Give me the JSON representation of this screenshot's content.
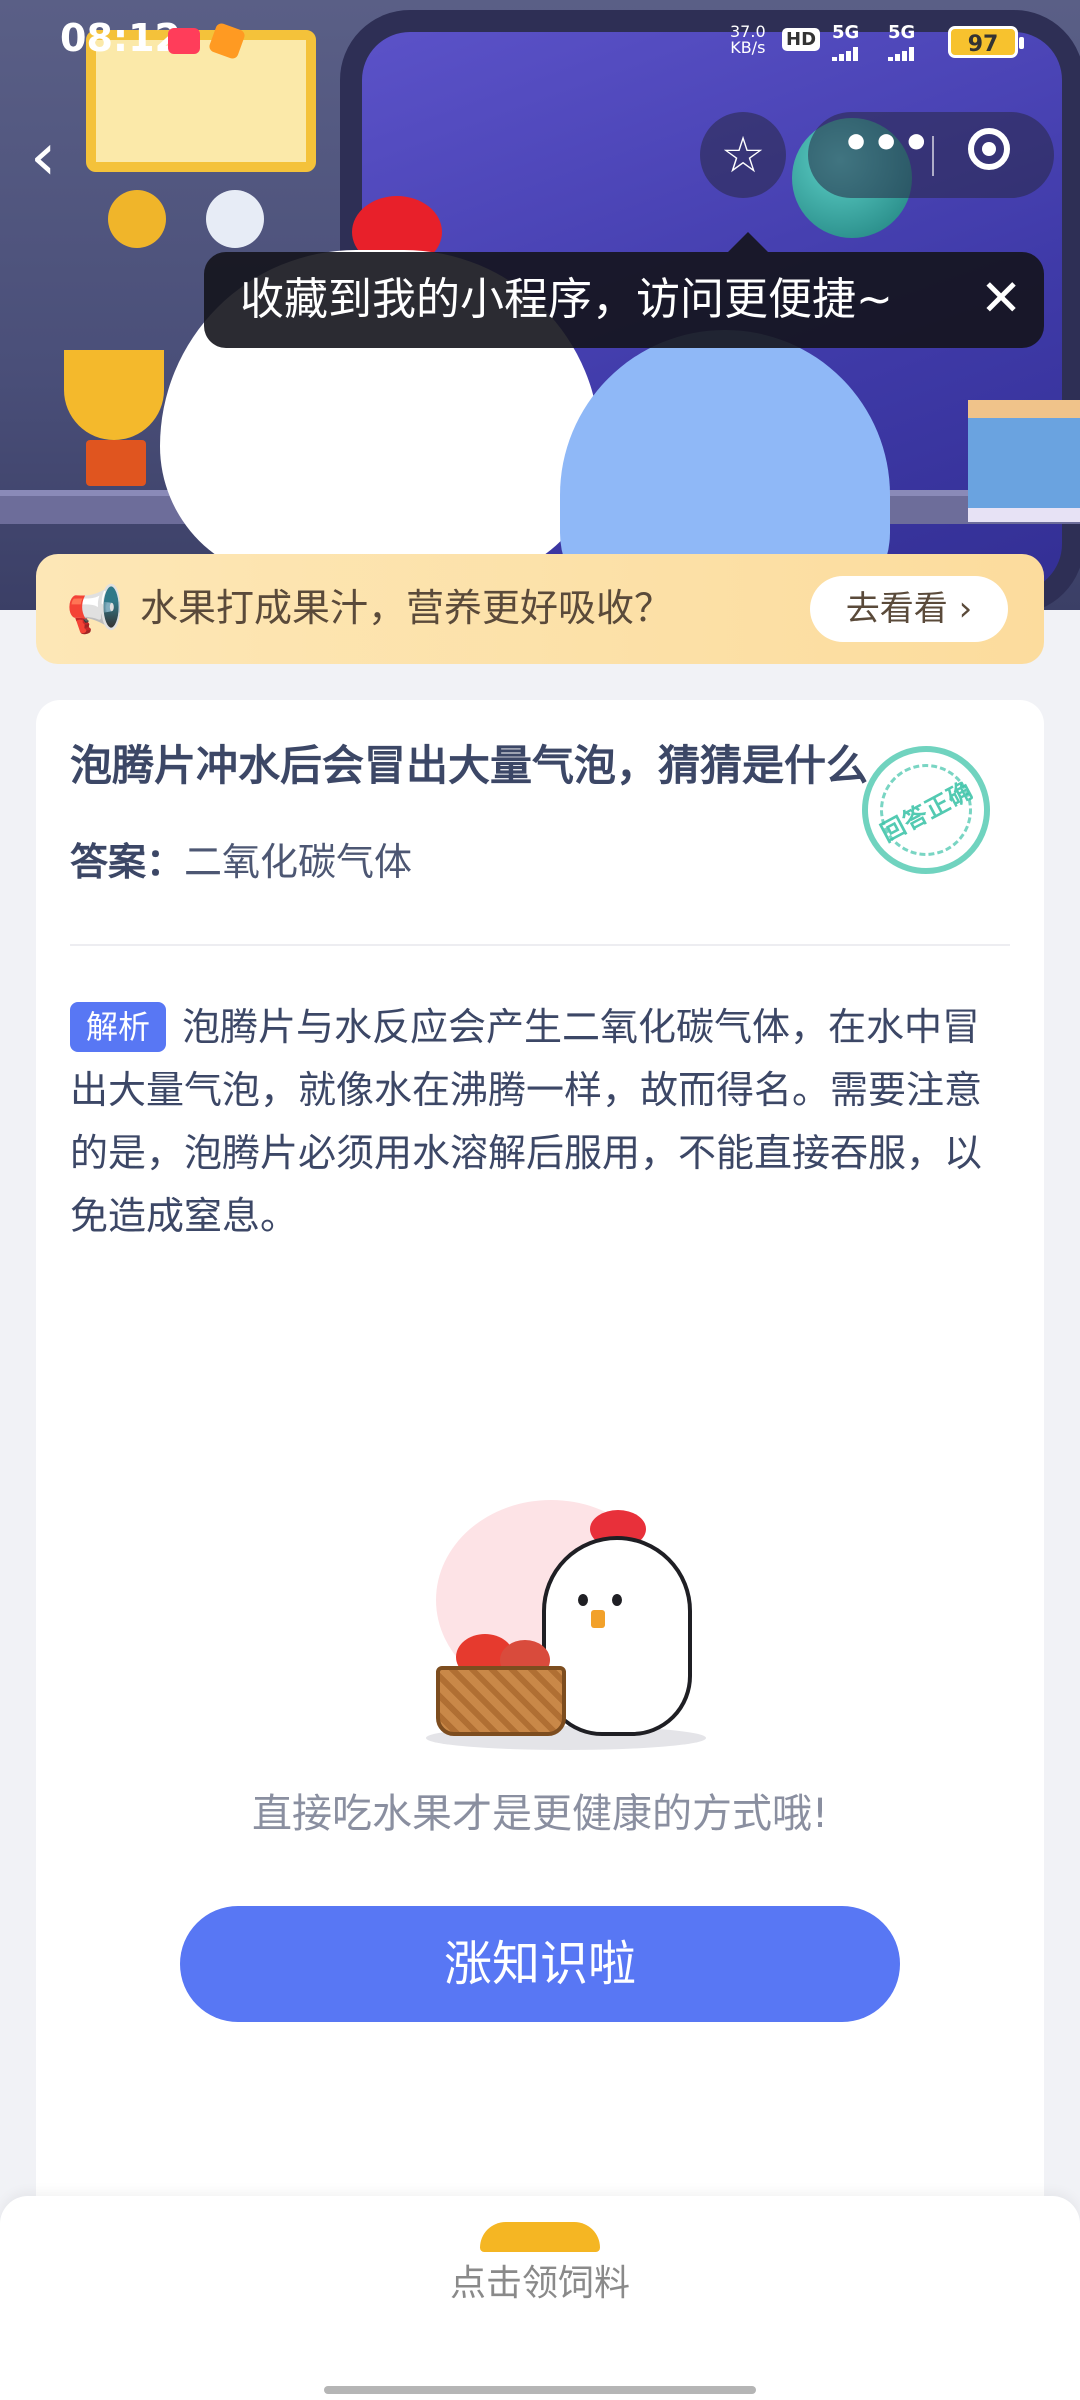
{
  "status_bar": {
    "time": "08:12",
    "network_speed_value": "37.0",
    "network_speed_unit": "KB/s",
    "hd_label": "HD",
    "signal1": "5G",
    "signal2": "5G",
    "battery": "97"
  },
  "nav": {
    "back_icon": "chevron-left-icon",
    "favorite_icon": "star-icon",
    "more_label": "•••",
    "close_icon": "target-icon"
  },
  "tooltip": {
    "text": "收藏到我的小程序，访问更便捷~",
    "close_label": "✕"
  },
  "notice": {
    "icon": "megaphone-icon",
    "text": "水果打成果汁，营养更好吸收？",
    "button_label": "去看看 ›"
  },
  "question": {
    "title": "泡腾片冲水后会冒出大量气泡，猜猜是什么",
    "answer_label": "答案：",
    "answer_value": "二氧化碳气体",
    "stamp_text": "回答正确",
    "analysis_tag": "解析",
    "analysis_text": "泡腾片与水反应会产生二氧化碳气体，在水中冒出大量气泡，就像水在沸腾一样，故而得名。需要注意的是，泡腾片必须用水溶解后服用，不能直接吞服，以免造成窒息。"
  },
  "footer_tip": "直接吃水果才是更健康的方式哦!",
  "cta_label": "涨知识啦",
  "bottom_bar": {
    "label": "点击领饲料"
  },
  "colors": {
    "accent": "#5877f4",
    "notice_bg": "#fde7b6",
    "stamp": "#40c4aa"
  }
}
